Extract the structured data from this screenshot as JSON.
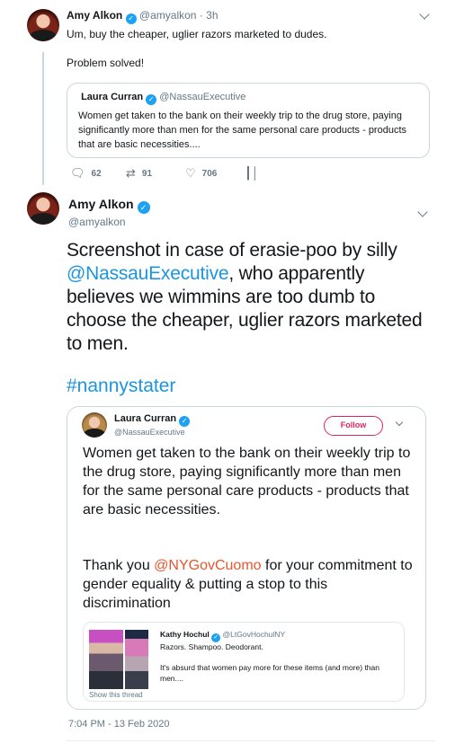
{
  "tweet_reply": {
    "name": "Amy Alkon",
    "handle": "@amyalkon",
    "time": "3h",
    "text": "Um, buy the cheaper, uglier razors marketed to dudes.\n\nProblem solved!",
    "quoted": {
      "name": "Laura Curran",
      "handle": "@NassauExecutive",
      "text": "Women get taken to the bank on their weekly trip to the drug store, paying significantly more than men for the same personal care products - products that are basic necessities...."
    },
    "actions": {
      "replies": "62",
      "retweets": "91",
      "likes": "706"
    }
  },
  "tweet_main": {
    "name": "Amy Alkon",
    "handle": "@amyalkon",
    "text_before_mention": "Screenshot in case of erasie-poo by silly ",
    "mention": "@NassauExecutive",
    "text_after_mention": ", who apparently believes we wimmins are too dumb to choose the cheaper, uglier razors marketed to men.",
    "hashtag": "#nannystater",
    "timestamp": "7:04 PM - 13 Feb 2020"
  },
  "screenshot_card": {
    "name": "Laura Curran",
    "handle": "@NassauExecutive",
    "follow_label": "Follow",
    "text": "Women get taken to the bank on their weekly trip to the drug store, paying significantly more than men for the same personal care products - products that are basic necessities.",
    "thank_before": "Thank you ",
    "thank_mention": "@NYGovCuomo",
    "thank_after": " for your commitment to gender equality & putting a stop to this discrimination",
    "inner_quote": {
      "name": "Kathy Hochul",
      "handle": "@LtGovHochulNY",
      "line1": "Razors. Shampoo. Deodorant.",
      "line2": "It's absurd that women pay more for these items (and more) than men....",
      "show_thread": "Show this thread"
    }
  },
  "icons": {
    "reply": "reply-icon",
    "retweet": "retweet-icon",
    "like": "heart-icon",
    "analytics": "analytics-icon",
    "verified": "verified-badge-icon",
    "menu": "chevron-down-icon"
  },
  "colors": {
    "link": "#1b95e0",
    "verified": "#1da1f2",
    "follow_button": "#e0245e",
    "mention_in_screenshot": "#e8552d"
  }
}
